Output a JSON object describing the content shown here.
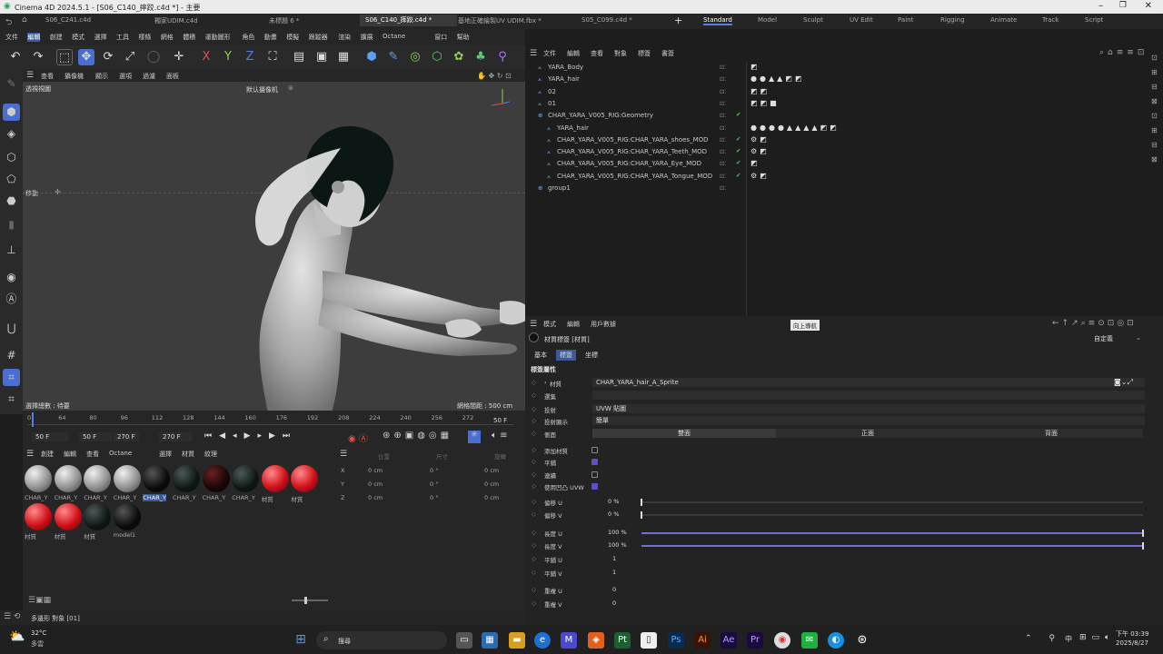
{
  "window": {
    "title": "Cinema 4D 2024.5.1 - [S06_C140_摔跤.c4d *] - 主要"
  },
  "tabs": [
    "S06_C241.c4d",
    "獨家UDIM.c4d",
    "未標題 6 *",
    "S06_C140_摔跤.c4d *",
    "基地正確繪製UV UDIM.fbx *",
    "S05_C099.c4d *"
  ],
  "layouts": [
    "Standard",
    "Model",
    "Sculpt",
    "UV Edit",
    "Paint",
    "Rigging",
    "Animate",
    "Track",
    "Script"
  ],
  "menu": [
    "文件",
    "編輯",
    "創建",
    "模式",
    "選擇",
    "工具",
    "樣條",
    "網格",
    "體積",
    "運動圖形",
    "角色",
    "動畫",
    "模擬",
    "跟蹤器",
    "渲染",
    "擴展",
    "Octane",
    "窗口",
    "幫助"
  ],
  "viewport": {
    "menu": [
      "查看",
      "攝像機",
      "顯示",
      "選項",
      "過濾",
      "面板"
    ],
    "label": "透視視圖",
    "camera": "默认摄像机",
    "move_label": "移動",
    "grid_info": "網格間距 : 500 cm",
    "selection_info": "選擇總數 : 待要"
  },
  "timeline": {
    "ticks": [
      "0",
      "64",
      "80",
      "96",
      "112",
      "128",
      "144",
      "160",
      "176",
      "192",
      "208",
      "224",
      "240",
      "256",
      "272"
    ],
    "current": "50 F",
    "start": "50 F",
    "start2": "50 F",
    "end": "270 F",
    "end2": "270 F",
    "frame_right": "50 F"
  },
  "materials": {
    "menu": [
      "創建",
      "編輯",
      "查看",
      "Octane",
      "選擇",
      "材質",
      "紋理"
    ],
    "row1": [
      {
        "label": "CHAR_Y",
        "color": "grey"
      },
      {
        "label": "CHAR_Y",
        "color": "grey"
      },
      {
        "label": "CHAR_Y",
        "color": "grey"
      },
      {
        "label": "CHAR_Y",
        "color": "grey"
      },
      {
        "label": "CHAR_Y",
        "color": "black",
        "selected": true
      },
      {
        "label": "CHAR_Y",
        "color": "dark"
      },
      {
        "label": "CHAR_Y",
        "color": "darkred"
      },
      {
        "label": "CHAR_Y",
        "color": "dark"
      },
      {
        "label": "材質",
        "color": "red"
      },
      {
        "label": "材質",
        "color": "red"
      }
    ],
    "row2": [
      {
        "label": "材質",
        "color": "red"
      },
      {
        "label": "材質",
        "color": "red"
      },
      {
        "label": "材質",
        "color": "dark"
      },
      {
        "label": "model1",
        "color": "black"
      }
    ]
  },
  "coords": {
    "header": [
      "位置",
      "尺寸",
      "旋轉"
    ],
    "rows": [
      {
        "axis": "X",
        "pos": "0 cm",
        "size": "0 °",
        "rot": "0 cm"
      },
      {
        "axis": "Y",
        "pos": "0 cm",
        "size": "0 °",
        "rot": "0 cm"
      },
      {
        "axis": "Z",
        "pos": "0 cm",
        "size": "0 °",
        "rot": "0 cm"
      }
    ]
  },
  "status": {
    "text": "多邊形 對象 [01]"
  },
  "objects": {
    "menu": [
      "文件",
      "編輯",
      "查看",
      "對象",
      "標簽",
      "書簽"
    ],
    "rows": [
      {
        "name": "YARA_Body",
        "indent": 0
      },
      {
        "name": "YARA_hair",
        "indent": 0
      },
      {
        "name": "02",
        "indent": 0
      },
      {
        "name": "01",
        "indent": 0
      },
      {
        "name": "CHAR_YARA_V005_RIG:Geometry",
        "indent": 0
      },
      {
        "name": "YARA_hair",
        "indent": 1
      },
      {
        "name": "CHAR_YARA_V005_RIG:CHAR_YARA_shoes_MOD",
        "indent": 1
      },
      {
        "name": "CHAR_YARA_V005_RIG:CHAR_YARA_Teeth_MOD",
        "indent": 1
      },
      {
        "name": "CHAR_YARA_V005_RIG:CHAR_YARA_Eye_MOD",
        "indent": 1
      },
      {
        "name": "CHAR_YARA_V005_RIG:CHAR_YARA_Tongue_MOD",
        "indent": 1
      },
      {
        "name": "group1",
        "indent": 0
      }
    ]
  },
  "attr": {
    "menu": [
      "模式",
      "編輯",
      "用戶數據"
    ],
    "tooltip": "向上導航",
    "tag_name": "材質標簽 [材質]",
    "preset": "自定義",
    "tabs": [
      "基本",
      "標簽",
      "坐標"
    ],
    "section": "標簽屬性",
    "material_label": "材質",
    "material_value": "CHAR_YARA_hair_A_Sprite",
    "selection_label": "選集",
    "projection_label": "投射",
    "projection_value": "UVW 貼圖",
    "projdisp_label": "投射顯示",
    "projdisp_value": "簡單",
    "side_label": "側面",
    "sides": [
      "雙面",
      "正面",
      "背面"
    ],
    "checks": [
      {
        "label": "添加材質",
        "on": false
      },
      {
        "label": "平鋪",
        "on": true
      },
      {
        "label": "連續",
        "on": false
      },
      {
        "label": "使用凹凸 UVW",
        "on": true
      }
    ],
    "offset_u_label": "偏移 U",
    "offset_u": "0 %",
    "offset_v_label": "偏移 V",
    "offset_v": "0 %",
    "len_u_label": "長度 U",
    "len_u": "100 %",
    "len_v_label": "長度 V",
    "len_v": "100 %",
    "tile_u_label": "平鋪 U",
    "tile_u": "1",
    "tile_v_label": "平鋪 V",
    "tile_v": "1",
    "rep_u_label": "重複 U",
    "rep_u": "0",
    "rep_v_label": "重複 V",
    "rep_v": "0"
  },
  "taskbar": {
    "weather_temp": "32°C",
    "weather_desc": "多雲",
    "search": "搜尋",
    "time": "下午 03:39",
    "date": "2025/8/27",
    "lang": "中"
  }
}
